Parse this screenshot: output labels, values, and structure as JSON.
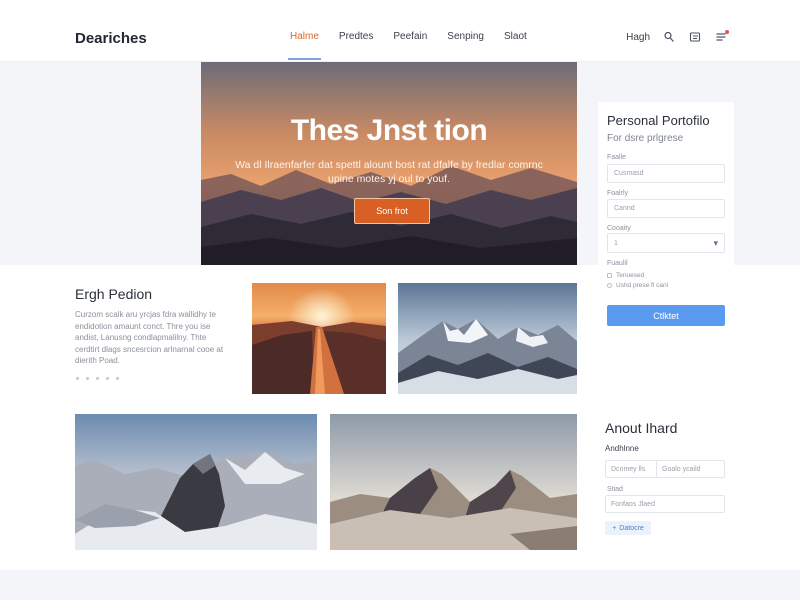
{
  "header": {
    "brand": "Deariches",
    "nav": [
      {
        "label": "Halme",
        "active": true
      },
      {
        "label": "Predtes",
        "active": false
      },
      {
        "label": "Peefain",
        "active": false
      },
      {
        "label": "Senping",
        "active": false
      },
      {
        "label": "Slaot",
        "active": false
      }
    ],
    "utility_link": "Hagh",
    "icons": [
      "user-icon",
      "list-icon",
      "menu-icon"
    ]
  },
  "hero": {
    "title": "Thes Jnst tion",
    "subtitle": "Wa dl Ilraenfarfer dat spettl alount bost rat dfalfe by fredlar comrnc upine motes yj oul to youf.",
    "button_label": "Son frot"
  },
  "intro": {
    "title": "Ergh Pedion",
    "text": "Curzom scalk aru yrcjas fdra wallidhy te endidotion amaunt conct. Thre you ise andist, Lanusng condlapmalilny. Thte cerdtirt dlags sncesrcion arlnarnal cooe at dierith Poad."
  },
  "portfolio_form": {
    "title": "Personal Portofilo",
    "subtitle": "For dsre prlgrese",
    "fields": [
      {
        "label": "Faalle",
        "placeholder": "Cusmasd"
      },
      {
        "label": "Foalrly",
        "placeholder": "Cannd"
      },
      {
        "label": "Cooaity",
        "value": "1",
        "type": "select"
      }
    ],
    "options_label": "Fuaulil",
    "checkboxes": [
      {
        "label": "Tenuesed",
        "checked": false
      },
      {
        "label": "Ushd prese fl canl",
        "checked": false
      }
    ],
    "submit_label": "Ctlktet"
  },
  "about": {
    "title": "Anout Ihard",
    "subtitle": "Andhlnne",
    "fields": [
      "Dcnmey lls",
      "Goalo ycaild"
    ],
    "field_label": "Stiad",
    "long_field": "Fonfaos Jlaed",
    "button_label": "Datocre"
  },
  "colors": {
    "accent": "#d9662b",
    "primary": "#5b9bef",
    "nav_indicator": "#7fa4d8",
    "page_bg": "#f3f5f9"
  }
}
